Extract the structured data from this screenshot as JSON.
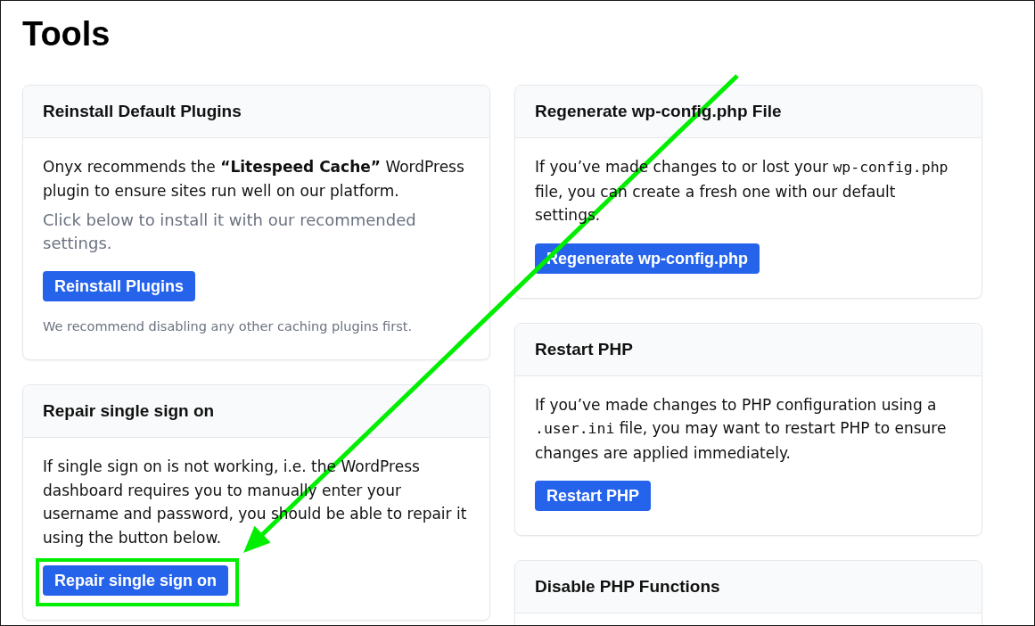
{
  "page": {
    "title": "Tools"
  },
  "columns": [
    {
      "cards": [
        {
          "title": "Reinstall Default Plugins",
          "paragraphs": [
            {
              "muted": false,
              "parts": [
                {
                  "kind": "text",
                  "text": "Onyx recommends the **“Litespeed Cache”** WordPress plugin to ensure sites run well on our platform."
                }
              ]
            },
            {
              "muted": true,
              "parts": [
                {
                  "kind": "text",
                  "text": "Click below to install it with our recommended settings."
                }
              ]
            }
          ],
          "button": {
            "label": "Reinstall Plugins",
            "highlighted": false
          },
          "note": "We recommend disabling any other caching plugins first."
        },
        {
          "title": "Repair single sign on",
          "paragraphs": [
            {
              "muted": false,
              "parts": [
                {
                  "kind": "text",
                  "text": "If single sign on is not working, i.e. the WordPress dashboard requires you to manually enter your username and password, you should be able to repair it using the button below."
                }
              ]
            }
          ],
          "button": {
            "label": "Repair single sign on",
            "highlighted": true
          }
        }
      ]
    },
    {
      "cards": [
        {
          "title": "Regenerate wp-config.php File",
          "paragraphs": [
            {
              "muted": false,
              "parts": [
                {
                  "kind": "text",
                  "text": "If you’ve made changes to or lost your "
                },
                {
                  "kind": "code",
                  "text": "wp-config.php"
                },
                {
                  "kind": "text",
                  "text": " file, you can create a fresh one with our default settings."
                }
              ]
            }
          ],
          "button": {
            "label": "Regenerate wp-config.php",
            "highlighted": false
          }
        },
        {
          "title": "Restart PHP",
          "paragraphs": [
            {
              "muted": false,
              "parts": [
                {
                  "kind": "text",
                  "text": "If you’ve made changes to PHP configuration using a "
                },
                {
                  "kind": "code",
                  "text": ".user.ini"
                },
                {
                  "kind": "text",
                  "text": " file, you may want to restart PHP to ensure changes are applied immediately."
                }
              ]
            }
          ],
          "button": {
            "label": "Restart PHP",
            "highlighted": false
          }
        },
        {
          "title": "Disable PHP Functions"
        }
      ]
    }
  ]
}
